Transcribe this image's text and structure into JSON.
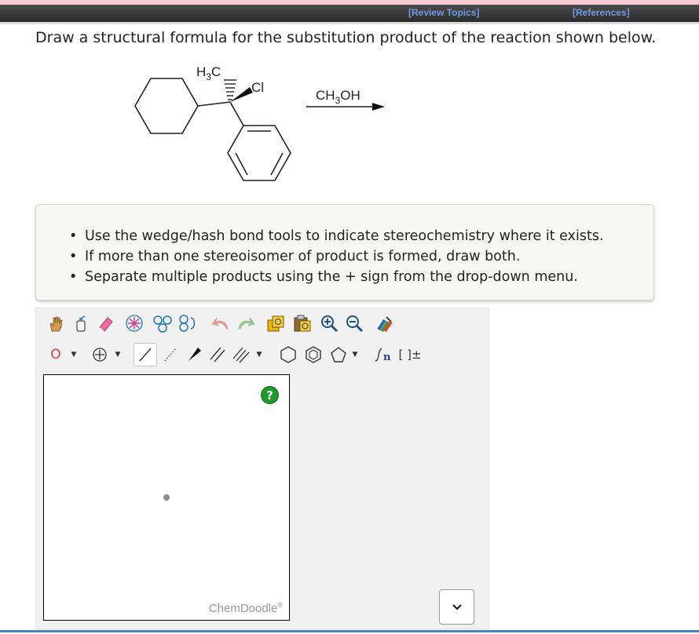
{
  "header": {
    "review_topics": "[Review Topics]",
    "references": "[References]"
  },
  "question": {
    "text": "Draw a structural formula for the substitution product of the reaction shown below."
  },
  "reaction": {
    "methyl_label_h": "H",
    "methyl_label_sub": "3",
    "methyl_label_c": "C",
    "chloro_label": "Cl",
    "reagent_ch": "CH",
    "reagent_sub": "3",
    "reagent_oh": "OH"
  },
  "hints": {
    "items": [
      "Use the wedge/hash bond tools to indicate stereochemistry where it exists.",
      "If more than one stereoisomer of product is formed, draw both.",
      "Separate multiple products using the + sign from the drop-down menu."
    ]
  },
  "sketcher": {
    "atom_label": "O",
    "charge_bracket": "[ ]±",
    "help": "?",
    "brand": "ChemDoodle",
    "brand_mark": "®",
    "accent_green": "#1f9a2a",
    "atom_red": "#e53935",
    "toolbar_icons": [
      "hand-icon",
      "clear-icon",
      "eraser-icon",
      "center-icon",
      "flip-horizontal-icon",
      "flip-vertical-icon",
      "undo-icon",
      "redo-icon",
      "template-icon",
      "paste-icon",
      "zoom-in-icon",
      "zoom-out-icon",
      "clean-icon",
      "element-icon",
      "charge-icon",
      "single-bond-icon",
      "hash-bond-icon",
      "wedge-bond-icon",
      "double-bond-icon",
      "triple-bond-icon",
      "hexagon-ring-icon",
      "benzene-ring-icon",
      "pentagon-ring-icon",
      "chain-icon",
      "bracket-icon"
    ]
  }
}
